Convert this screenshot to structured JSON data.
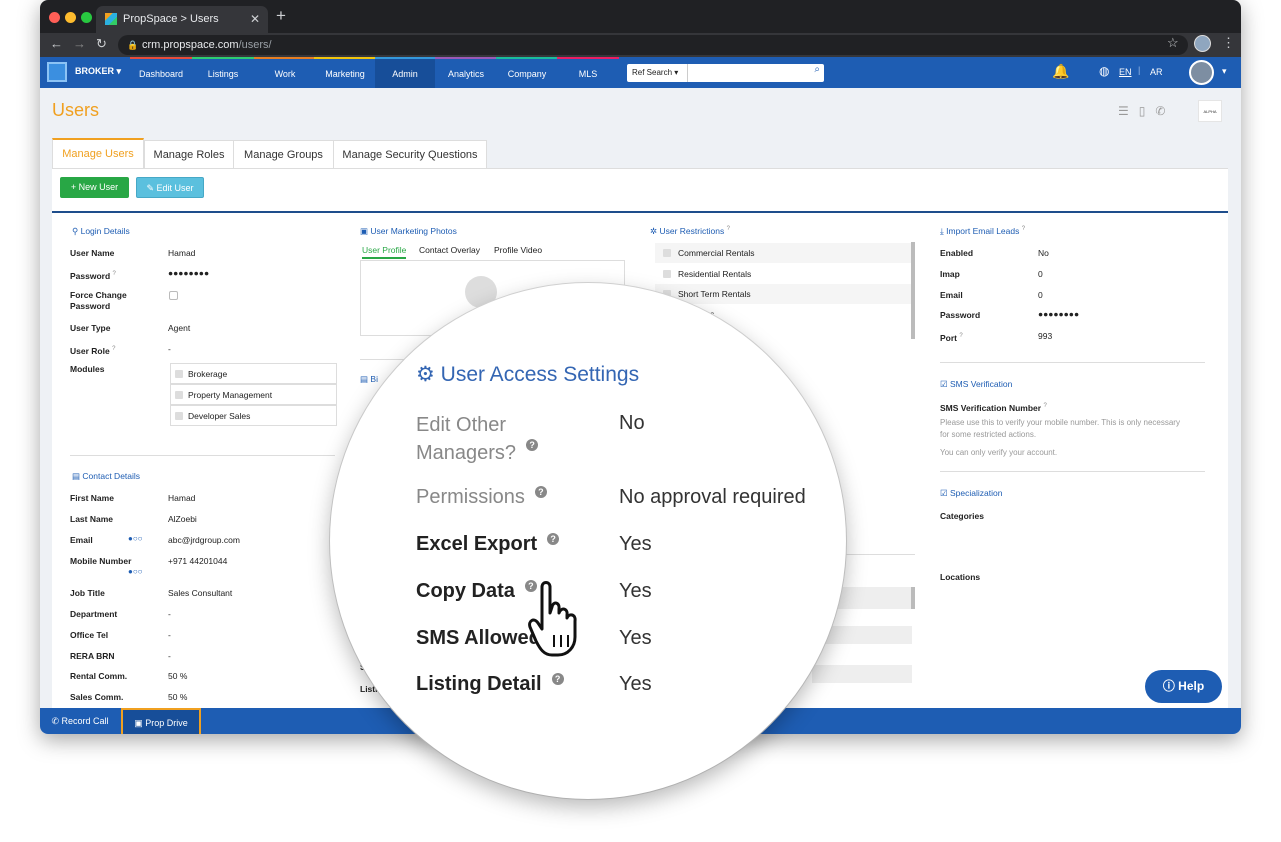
{
  "browser": {
    "tab_title": "PropSpace > Users",
    "url_host": "crm.propspace.com",
    "url_path": "/users/"
  },
  "nav": {
    "role": "BROKER",
    "menu": [
      "Dashboard",
      "Listings",
      "Work",
      "Marketing",
      "Admin",
      "Analytics",
      "Company",
      "MLS"
    ],
    "search_select": "Ref Search",
    "lang_en": "EN",
    "lang_ar": "AR"
  },
  "page": {
    "title": "Users",
    "logo_text": "ALPHA"
  },
  "tabs": [
    "Manage Users",
    "Manage Roles",
    "Manage Groups",
    "Manage Security Questions"
  ],
  "buttons": {
    "new_user": "New User",
    "edit_user": "Edit User"
  },
  "login": {
    "heading": "Login Details",
    "rows": [
      [
        "User Name",
        "Hamad"
      ],
      [
        "Password",
        "●●●●●●●●"
      ],
      [
        "Force Change Password",
        ""
      ],
      [
        "User Type",
        "Agent"
      ],
      [
        "User Role",
        "-"
      ],
      [
        "Modules",
        ""
      ]
    ],
    "modules": [
      "Brokerage",
      "Property Management",
      "Developer Sales"
    ]
  },
  "contact": {
    "heading": "Contact Details",
    "rows": [
      [
        "First Name",
        "Hamad"
      ],
      [
        "Last Name",
        "AlZoebi"
      ],
      [
        "Email",
        "abc@jrdgroup.com"
      ],
      [
        "Mobile Number",
        "+971 44201044"
      ],
      [
        "Job Title",
        "Sales Consultant"
      ],
      [
        "Department",
        "-"
      ],
      [
        "Office Tel",
        "-"
      ],
      [
        "RERA BRN",
        "-"
      ],
      [
        "Rental Comm.",
        "50 %"
      ],
      [
        "Sales Comm.",
        "50 %"
      ]
    ]
  },
  "marketing": {
    "heading": "User Marketing Photos",
    "subtabs": [
      "User Profile",
      "Contact Overlay",
      "Profile Video"
    ],
    "bio_label": "Bi",
    "frag_s": "S",
    "frag_list": "Listi"
  },
  "restrictions": {
    "heading": "User Restrictions",
    "items": [
      "Commercial Rentals",
      "Residential Rentals",
      "Short Term Rentals",
      "cial Sales"
    ]
  },
  "email_leads": {
    "heading": "Import Email Leads",
    "rows": [
      [
        "Enabled",
        "No"
      ],
      [
        "Imap",
        "0"
      ],
      [
        "Email",
        "0"
      ],
      [
        "Password",
        "●●●●●●●●"
      ],
      [
        "Port",
        "993"
      ]
    ]
  },
  "sms": {
    "heading": "SMS Verification",
    "label": "SMS Verification Number",
    "help1": "Please use this to verify your mobile number. This is only necessary for some restricted actions.",
    "help2": "You can only verify your account."
  },
  "specialization": {
    "heading": "Specialization",
    "categories": "Categories",
    "locations": "Locations"
  },
  "help": "Help",
  "bottom": {
    "record_call": "Record Call",
    "prop_drive": "Prop Drive"
  },
  "access": {
    "heading": "User Access Settings",
    "rows": [
      {
        "label": "Edit Other Managers?",
        "value": "No"
      },
      {
        "label": "Permissions",
        "value": "No approval required"
      },
      {
        "label": "Excel Export",
        "value": "Yes"
      },
      {
        "label": "Copy Data",
        "value": "Yes"
      },
      {
        "label": "SMS Allowed",
        "value": "Yes"
      },
      {
        "label": "Listing Detail",
        "value": "Yes"
      }
    ]
  },
  "colors": {
    "brand_blue": "#1e5db3",
    "accent_orange": "#f0a020",
    "green": "#28a745",
    "light_blue": "#5bc0de"
  }
}
